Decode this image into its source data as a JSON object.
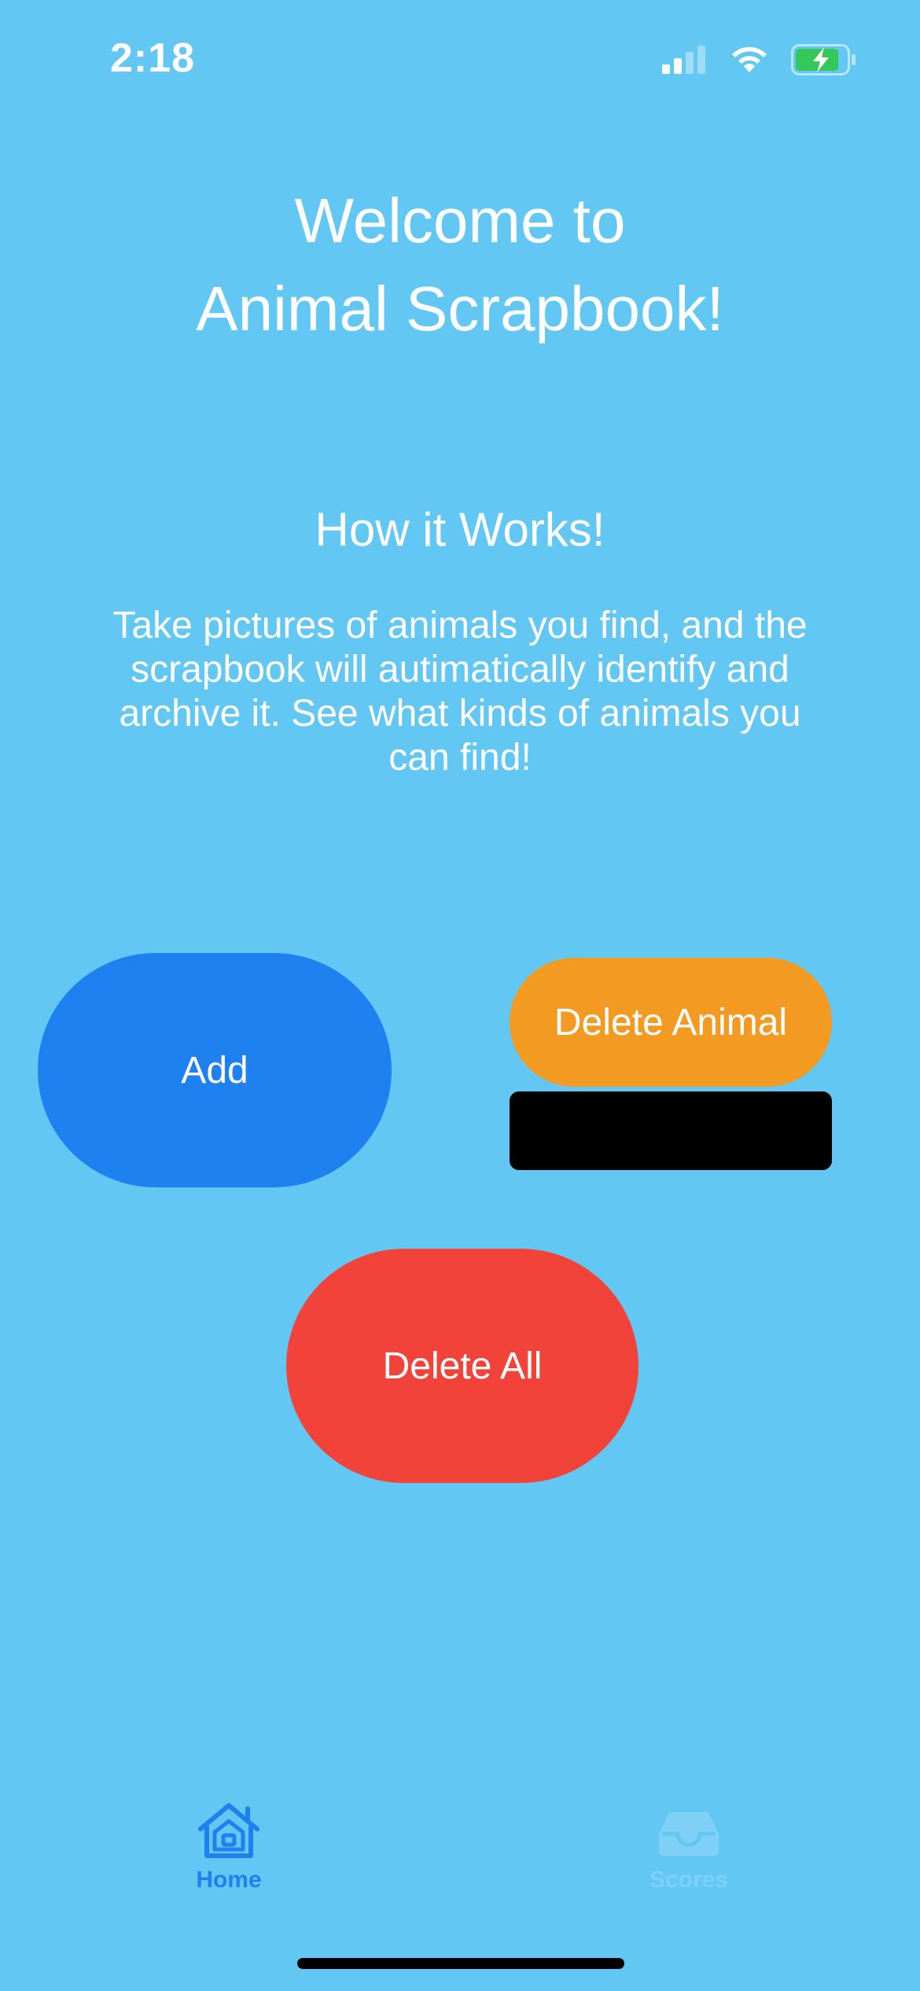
{
  "status_bar": {
    "time": "2:18"
  },
  "header": {
    "title_line1": "Welcome to",
    "title_line2": "Animal Scrapbook!"
  },
  "how_it_works": {
    "heading": "How it Works!",
    "description": "Take pictures of animals you find, and the scrapbook will autimatically identify and archive it. See what kinds of animals you can find!"
  },
  "actions": {
    "add_label": "Add",
    "delete_animal_label": "Delete Animal",
    "delete_all_label": "Delete All"
  },
  "tab_bar": {
    "home_label": "Home",
    "scores_label": "Scores",
    "selected": "Home"
  },
  "colors": {
    "background": "#63c7f4",
    "add_button": "#1f80f0",
    "delete_animal_button": "#f29a22",
    "delete_all_button": "#f2433a",
    "tab_active": "#1f80f0",
    "tab_inactive": "#7fd0f6"
  },
  "icons": {
    "signal": "cellular-signal-icon",
    "wifi": "wifi-icon",
    "battery": "battery-charging-icon",
    "home_tab": "house-icon",
    "scores_tab": "tray-icon"
  }
}
